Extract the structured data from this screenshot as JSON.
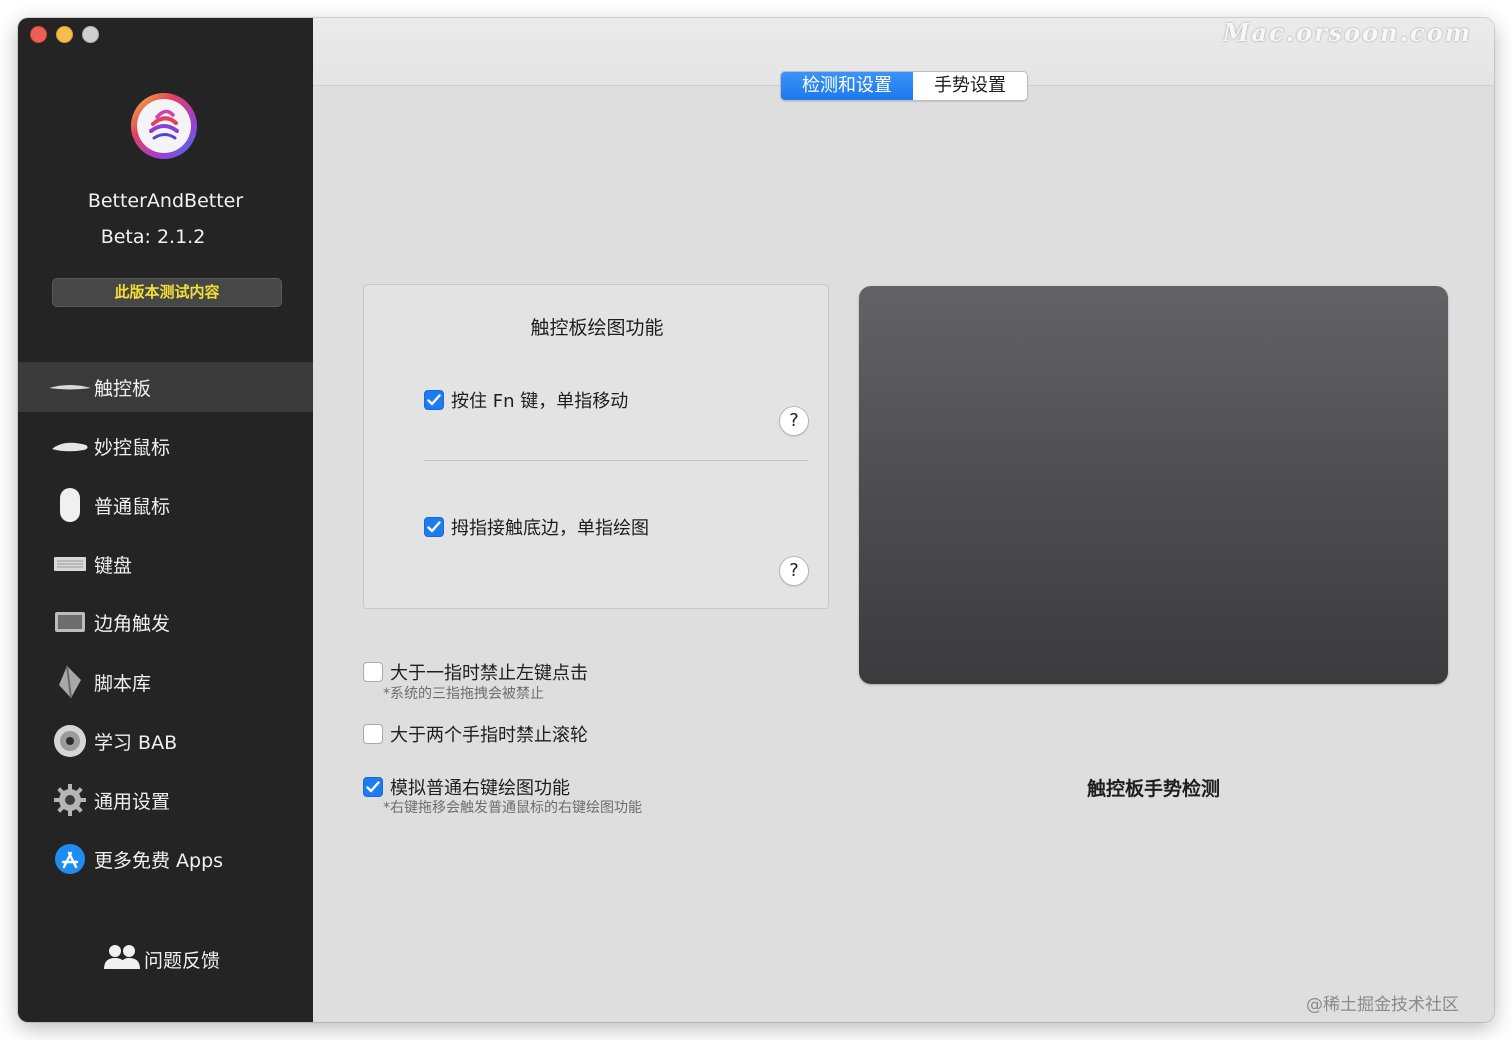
{
  "window": {
    "watermark": "Mac.orsoon.com"
  },
  "sidebar": {
    "app_name": "BetterAndBetter",
    "version": "Beta:  2.1.2",
    "beta_button": "此版本测试内容",
    "items": [
      {
        "label": "触控板",
        "icon": "trackpad-icon",
        "active": true
      },
      {
        "label": "妙控鼠标",
        "icon": "magic-mouse-icon"
      },
      {
        "label": "普通鼠标",
        "icon": "mouse-icon"
      },
      {
        "label": "键盘",
        "icon": "keyboard-icon"
      },
      {
        "label": "边角触发",
        "icon": "corner-trigger-icon"
      },
      {
        "label": "脚本库",
        "icon": "script-icon"
      },
      {
        "label": "学习 BAB",
        "icon": "disc-icon"
      },
      {
        "label": "通用设置",
        "icon": "gear-icon"
      },
      {
        "label": "更多免费 Apps",
        "icon": "app-store-icon"
      }
    ],
    "feedback": "问题反馈"
  },
  "tabs": [
    {
      "label": "检测和设置",
      "active": true
    },
    {
      "label": "手势设置",
      "active": false
    }
  ],
  "panel": {
    "title": "触控板绘图功能",
    "option1": {
      "label": "按住 Fn 键，单指移动",
      "checked": true
    },
    "option2": {
      "label": "拇指接触底边，单指绘图",
      "checked": true
    },
    "help": "?"
  },
  "options": [
    {
      "label": "大于一指时禁止左键点击",
      "checked": false,
      "note": "*系统的三指拖拽会被禁止"
    },
    {
      "label": "大于两个手指时禁止滚轮",
      "checked": false
    },
    {
      "label": "模拟普通右键绘图功能",
      "checked": true,
      "note": "*右键拖移会触发普通鼠标的右键绘图功能"
    }
  ],
  "trackpad_label": "触控板手势检测",
  "footer_watermark": "@稀土掘金技术社区",
  "colors": {
    "accent": "#1e7cf2",
    "sidebar_bg": "#242424",
    "beta_text": "#f3df36"
  }
}
